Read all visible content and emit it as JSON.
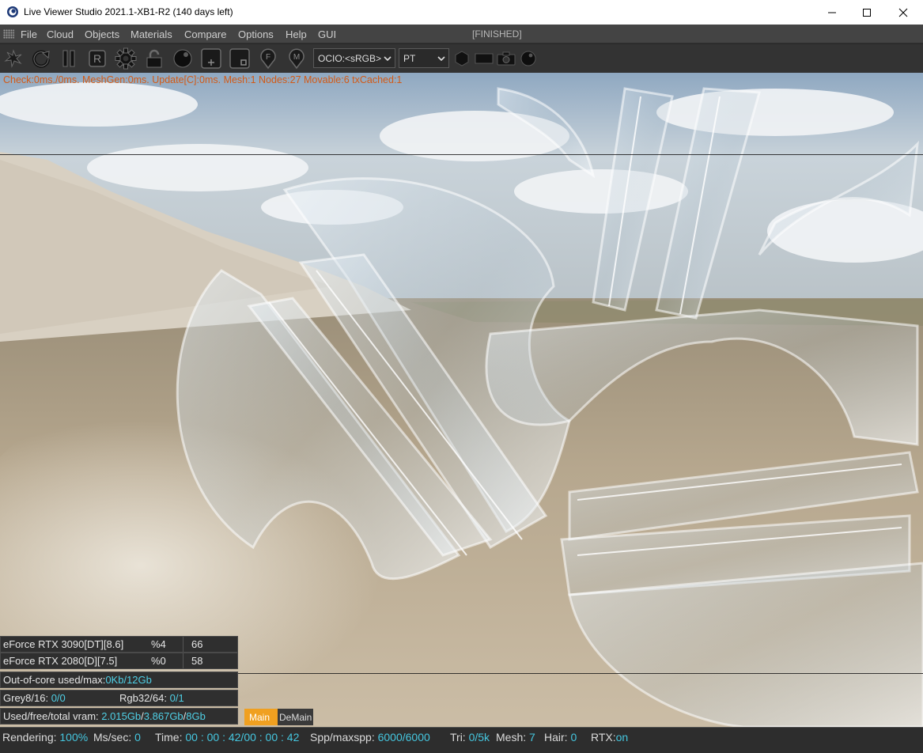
{
  "window": {
    "title": "Live Viewer Studio 2021.1-XB1-R2 (140 days left)",
    "minimize_icon": "minimize-icon",
    "maximize_icon": "maximize-icon",
    "close_icon": "close-icon"
  },
  "menu": {
    "items": [
      "File",
      "Cloud",
      "Objects",
      "Materials",
      "Compare",
      "Options",
      "Help",
      "GUI"
    ],
    "status": "[FINISHED]"
  },
  "toolbar": {
    "icons": [
      "recenter-icon",
      "reset-icon",
      "pause-icon",
      "region-icon",
      "settings-icon",
      "lock-icon",
      "sphere-icon",
      "add-box-icon",
      "box-icon",
      "focus-pin-icon",
      "material-pin-icon"
    ],
    "region_label": "R",
    "focus_label": "F",
    "material_label": "M",
    "color_space": {
      "value": "OCIO:<sRGB>"
    },
    "kernel": {
      "value": "PT"
    },
    "right_icons": [
      "hexagon-icon",
      "film-icon",
      "camera-icon",
      "sphere-small-icon"
    ]
  },
  "viewport": {
    "check_line": "Check:0ms./0ms. MeshGen:0ms. Update[C]:0ms. Mesh:1 Nodes:27 Movable:6 txCached:1"
  },
  "gpus": [
    {
      "name": "eForce RTX 3090[DT][8.6]",
      "percent": "%4",
      "temp": "66"
    },
    {
      "name": "eForce RTX 2080[D][7.5]",
      "percent": "%0",
      "temp": "58"
    }
  ],
  "memory": {
    "out_of_core_label": "Out-of-core used/max:",
    "out_of_core_value": "0Kb/12Gb",
    "grey_label": "Grey8/16: ",
    "grey_value": "0/0",
    "rgb_label": "Rgb32/64: ",
    "rgb_value": "0/1",
    "vram_label": "Used/free/total vram: ",
    "vram_used": "2.015Gb",
    "vram_free": "3.867Gb",
    "vram_total": "8Gb",
    "sep": "/"
  },
  "tabs": {
    "main": "Main",
    "demain": "DeMain"
  },
  "status": {
    "rendering_label": "Rendering: ",
    "rendering_value": "100%",
    "ms_label": "Ms/sec: ",
    "ms_value": "0",
    "time_label": "Time: ",
    "time_value": "00 : 00 : 42/00 : 00 : 42",
    "spp_label": "Spp/maxspp: ",
    "spp_value": "6000/6000",
    "tri_label": "Tri: ",
    "tri_value": "0/5k",
    "mesh_label": "Mesh: ",
    "mesh_value": "7",
    "hair_label": "Hair: ",
    "hair_value": "0",
    "rtx_label": "RTX:",
    "rtx_value": "on"
  },
  "colors": {
    "accent_orange": "#f0a020",
    "check_text": "#d25a16",
    "value_cyan": "#4fd0e6"
  }
}
